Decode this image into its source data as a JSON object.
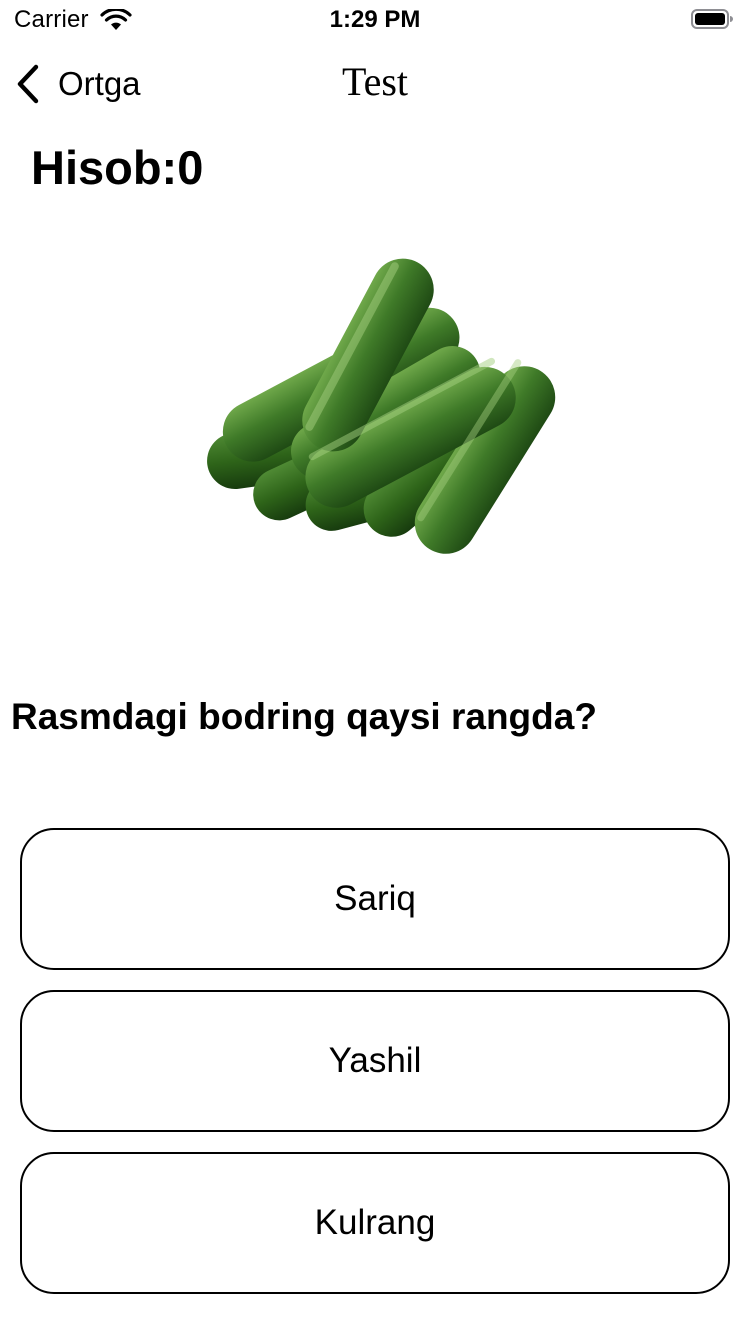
{
  "status_bar": {
    "carrier": "Carrier",
    "time": "1:29 PM",
    "icons": [
      "wifi-icon",
      "battery-icon"
    ]
  },
  "nav": {
    "back_label": "Ortga",
    "title": "Test",
    "back_icon": "chevron-left-icon"
  },
  "score": {
    "text": "Hisob:0"
  },
  "picture": {
    "subject_icon": "cucumber-image",
    "color": "#3f7a28"
  },
  "question": {
    "text": "Rasmdagi bodring qaysi rangda?"
  },
  "answers": [
    {
      "label": "Sariq"
    },
    {
      "label": "Yashil"
    },
    {
      "label": "Kulrang"
    }
  ],
  "colors": {
    "background": "#ffffff",
    "text": "#000000",
    "border": "#000000"
  }
}
